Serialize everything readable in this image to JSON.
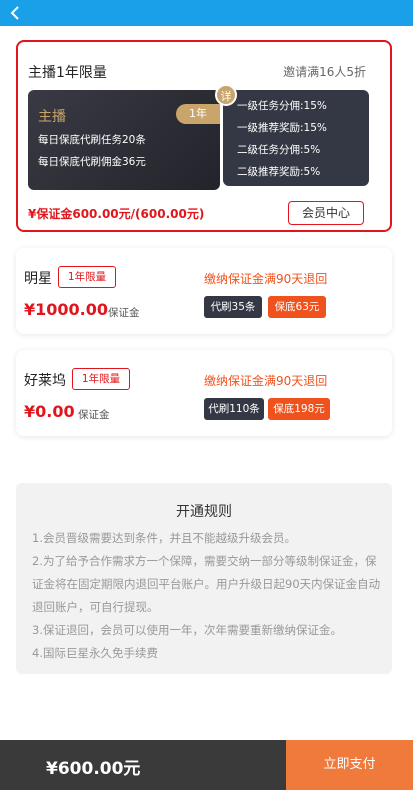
{
  "header": {
    "back_icon": "chevron-left-icon",
    "bar_color": "#1aa0e8"
  },
  "selected_plan": {
    "title": "主播1年限量",
    "invite_note": "邀请满16人5折",
    "role": "主播",
    "year_tag": "1年",
    "perks": [
      "每日保底代刷任务20条",
      "每日保底代刷佣金36元"
    ],
    "detail_badge": "详",
    "commissions": [
      "一级任务分佣:15%",
      "一级推荐奖励:15%",
      "二级任务分佣:5%",
      "二级推荐奖励:5%"
    ],
    "deposit": "¥保证金600.00元/(600.00元)",
    "member_center_label": "会员中心"
  },
  "plans": [
    {
      "name": "明星",
      "tag": "1年限量",
      "price": "¥1000.00",
      "price_label": "保证金",
      "refund_note": "缴纳保证金满90天退回",
      "pill_dark": "代刷35条",
      "pill_orange": "保底63元"
    },
    {
      "name": "好莱坞",
      "tag": "1年限量",
      "price": "¥0.00",
      "price_label": "保证金",
      "refund_note": "缴纳保证金满90天退回",
      "pill_dark": "代刷110条",
      "pill_orange": "保底198元"
    }
  ],
  "rules": {
    "title": "开通规则",
    "lines": [
      "1.会员晋级需要达到条件，并且不能越级升级会员。",
      "2.为了给予合作需求方一个保障，需要交纳一部分等级制保证金，保证金将在固定期限内退回平台账户。用户升级日起90天内保证金自动退回账户，可自行提现。",
      "3.保证退回，会员可以使用一年，次年需要重新缴纳保证金。",
      "4.国际巨星永久免手续费"
    ]
  },
  "footer": {
    "total": "¥600.00元",
    "pay_label": "立即支付"
  }
}
